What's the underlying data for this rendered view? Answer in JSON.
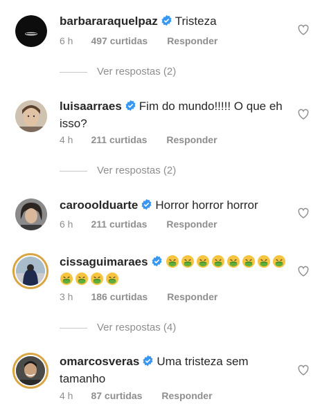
{
  "comments": [
    {
      "username": "barbararaquelpaz",
      "text": "Tristeza",
      "time": "6 h",
      "likes": "497 curtidas",
      "reply": "Responder",
      "view_replies": "Ver respostas (2)"
    },
    {
      "username": "luisaarraes",
      "text": "Fim do mundo!!!!! O que eh isso?",
      "time": "4 h",
      "likes": "211 curtidas",
      "reply": "Responder",
      "view_replies": "Ver respostas (2)"
    },
    {
      "username": "carooolduarte",
      "text": "Horror horror horror",
      "time": "6 h",
      "likes": "211 curtidas",
      "reply": "Responder"
    },
    {
      "username": "cissaguimaraes",
      "text": "",
      "emoji_count": 12,
      "time": "3 h",
      "likes": "186 curtidas",
      "reply": "Responder",
      "view_replies": "Ver respostas (4)"
    },
    {
      "username": "omarcosveras",
      "text": "Uma tristeza sem tamanho",
      "time": "4 h",
      "likes": "87 curtidas",
      "reply": "Responder"
    }
  ],
  "icons": {
    "verified": "verified-badge-icon",
    "like": "heart-icon",
    "emoji": "nauseated-face-emoji"
  },
  "colors": {
    "verified": "#3897f0",
    "muted": "#8e8e8e",
    "story_ring": "#d9a441",
    "emoji_face": "#f5c542",
    "emoji_mouth": "#5fae3b"
  }
}
